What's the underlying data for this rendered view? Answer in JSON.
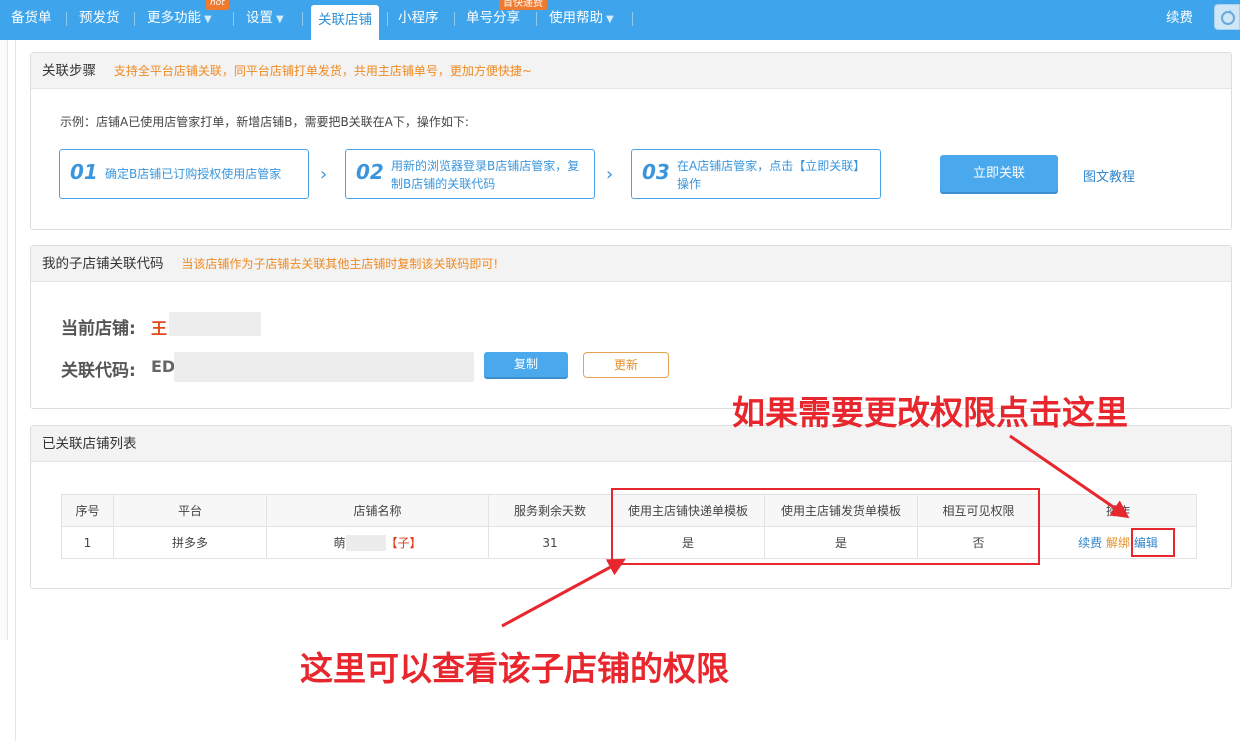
{
  "nav": {
    "items": [
      {
        "label": "备货单"
      },
      {
        "label": "预发货"
      },
      {
        "label": "更多功能",
        "badge": "hot"
      },
      {
        "label": "设置"
      },
      {
        "label": "关联店铺",
        "active": true
      },
      {
        "label": "小程序"
      },
      {
        "label": "单号分享",
        "badge": "首快递费"
      },
      {
        "label": "使用帮助"
      }
    ],
    "right_label": "续费"
  },
  "steps_panel": {
    "title": "关联步骤",
    "tip": "支持全平台店铺关联，同平台店铺打单发货，共用主店铺单号，更加方便快捷~",
    "example": "示例：店铺A已使用店管家打单，新增店铺B，需要把B关联在A下，操作如下:",
    "steps": [
      {
        "num": "01",
        "text": "确定B店铺已订购授权使用店管家"
      },
      {
        "num": "02",
        "text": "用新的浏览器登录B店铺店管家，复制B店铺的关联代码"
      },
      {
        "num": "03",
        "text": "在A店铺店管家，点击【立即关联】操作"
      }
    ],
    "primary_button": "立即关联",
    "tutorial_link": "图文教程"
  },
  "code_panel": {
    "title": "我的子店铺关联代码",
    "tip": "当该店铺作为子店铺去关联其他主店铺时复制该关联码即可!",
    "current_shop_label": "当前店铺:",
    "current_shop_value": "王",
    "code_label": "关联代码:",
    "code_value": "ED",
    "copy_button": "复制",
    "update_button": "更新"
  },
  "list_panel": {
    "title": "已关联店铺列表",
    "columns": [
      "序号",
      "平台",
      "店铺名称",
      "服务剩余天数",
      "使用主店铺快递单模板",
      "使用主店铺发货单模板",
      "相互可见权限",
      "操作"
    ],
    "rows": [
      {
        "index": "1",
        "platform": "拼多多",
        "shop_name": "萌",
        "shop_tag": "【子】",
        "days": "31",
        "express_tpl": "是",
        "ship_tpl": "是",
        "visible": "否",
        "actions": {
          "renew": "续费",
          "unbind": "解绑",
          "edit": "编辑"
        }
      }
    ]
  },
  "annotations": {
    "top": "如果需要更改权限点击这里",
    "bottom": "这里可以查看该子店铺的权限"
  },
  "colors": {
    "nav_bg": "#3ea4ec",
    "accent_blue": "#4aa9ec",
    "tip_orange": "#f08a22",
    "annotation_red": "#e8262d"
  }
}
